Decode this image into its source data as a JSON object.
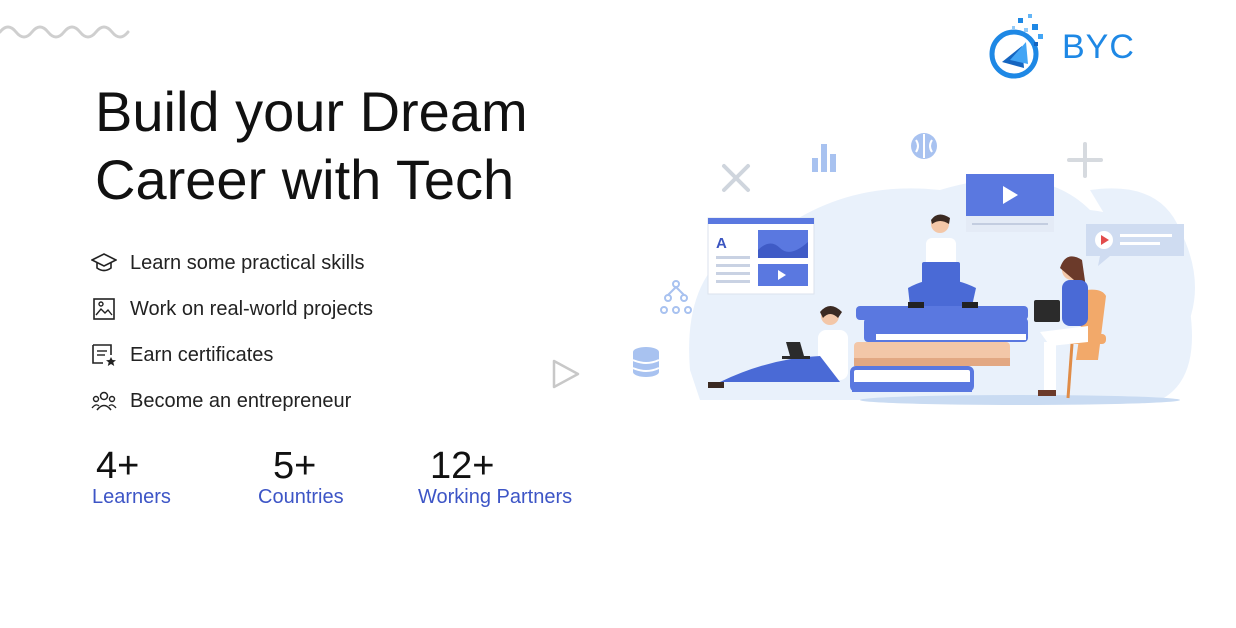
{
  "brand": {
    "name": "BYC",
    "logo_icon": "byc-logo-icon"
  },
  "hero": {
    "line1": "Build your Dream",
    "line2": "Career with Tech"
  },
  "features": [
    {
      "icon": "graduation-cap-icon",
      "label": "Learn some practical skills"
    },
    {
      "icon": "project-image-icon",
      "label": "Work on real-world projects"
    },
    {
      "icon": "certificate-icon",
      "label": "Earn certificates"
    },
    {
      "icon": "entrepreneur-group-icon",
      "label": "Become an entrepreneur"
    }
  ],
  "stats": [
    {
      "value": "4+",
      "label": "Learners"
    },
    {
      "value": "5+",
      "label": "Countries"
    },
    {
      "value": "12+",
      "label": "Working Partners"
    }
  ],
  "colors": {
    "accent": "#3d55c6",
    "brand_blue": "#1e88e5",
    "illustration_blue": "#5a78e0"
  }
}
